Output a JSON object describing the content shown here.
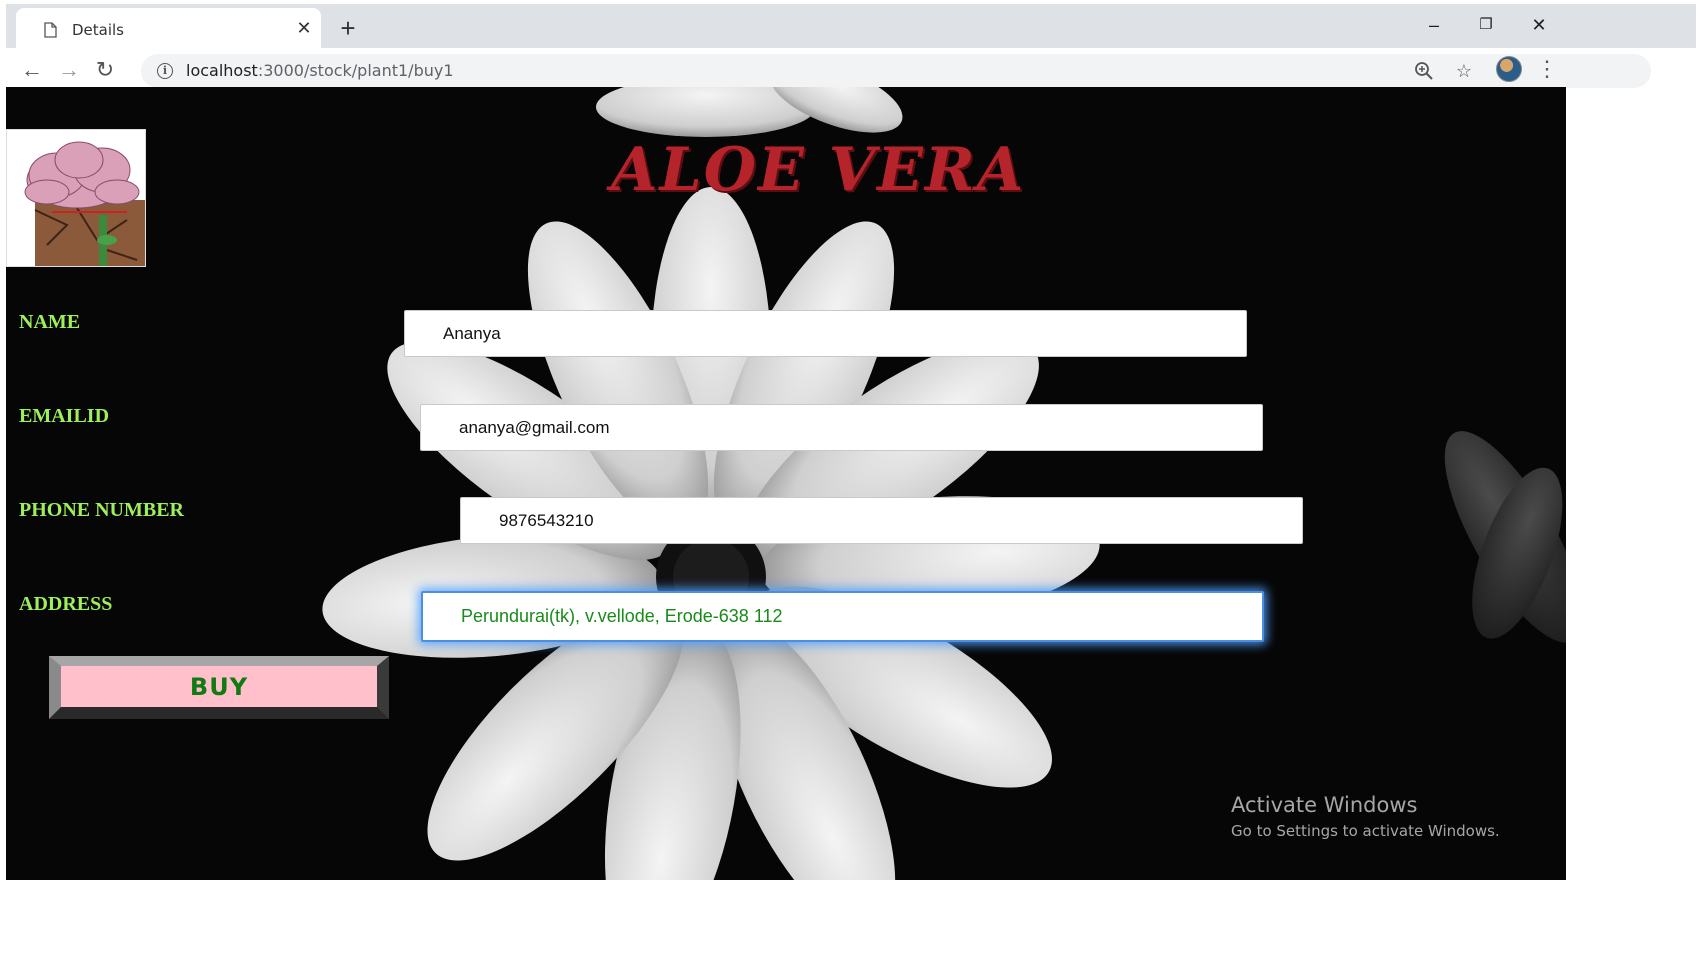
{
  "browser": {
    "tab_title": "Details",
    "url_host": "localhost",
    "url_path": ":3000/stock/plant1/buy1",
    "icons": {
      "tab": "document-icon",
      "close": "close-icon",
      "new_tab": "plus-icon",
      "back": "back-arrow-icon",
      "forward": "forward-arrow-icon",
      "reload": "reload-icon",
      "info": "info-icon",
      "zoom": "zoom-icon",
      "bookmark": "star-icon",
      "profile": "avatar",
      "menu": "kebab-menu-icon",
      "minimize": "minimize-icon",
      "restore": "restore-icon",
      "window_close": "window-close-icon"
    }
  },
  "page": {
    "title": "ALOE VERA",
    "title_color": "#b5232b",
    "label_color": "#9ef05a",
    "fields": {
      "name": {
        "label": "NAME",
        "value": "Ananya"
      },
      "email": {
        "label": "EMAILID",
        "value": "ananya@gmail.com"
      },
      "phone": {
        "label": "PHONE NUMBER",
        "value": "9876543210"
      },
      "address": {
        "label": "ADDRESS",
        "value": "Perundurai(tk), v.vellode, Erode-638 112"
      }
    },
    "buy_button": {
      "label": "BUY",
      "background": "#ffc0cb",
      "text_color": "#127a12"
    }
  },
  "watermark": {
    "line1": "Activate Windows",
    "line2": "Go to Settings to activate Windows."
  }
}
